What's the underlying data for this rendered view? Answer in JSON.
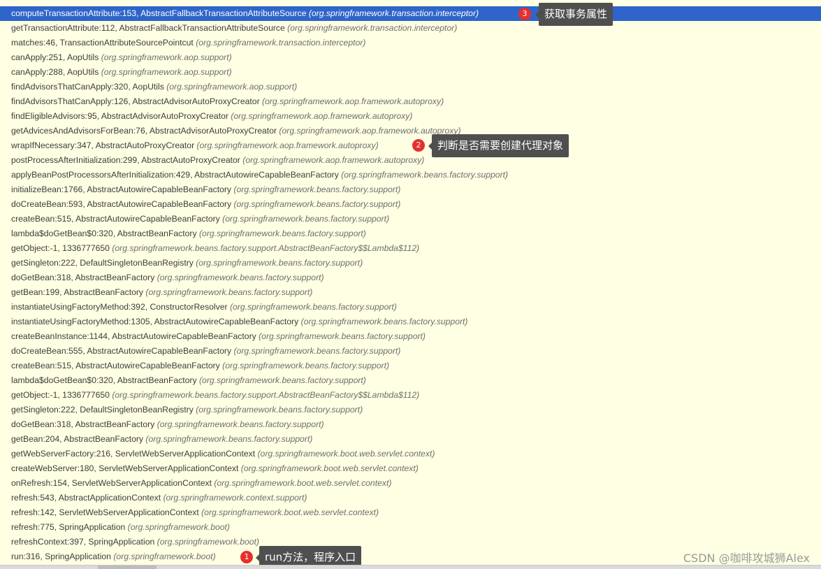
{
  "frames": [
    {
      "method": "computeTransactionAttribute:153, AbstractFallbackTransactionAttributeSource",
      "pkg": "(org.springframework.transaction.interceptor)",
      "selected": true
    },
    {
      "method": "getTransactionAttribute:112, AbstractFallbackTransactionAttributeSource",
      "pkg": "(org.springframework.transaction.interceptor)"
    },
    {
      "method": "matches:46, TransactionAttributeSourcePointcut",
      "pkg": "(org.springframework.transaction.interceptor)"
    },
    {
      "method": "canApply:251, AopUtils",
      "pkg": "(org.springframework.aop.support)"
    },
    {
      "method": "canApply:288, AopUtils",
      "pkg": "(org.springframework.aop.support)"
    },
    {
      "method": "findAdvisorsThatCanApply:320, AopUtils",
      "pkg": "(org.springframework.aop.support)"
    },
    {
      "method": "findAdvisorsThatCanApply:126, AbstractAdvisorAutoProxyCreator",
      "pkg": "(org.springframework.aop.framework.autoproxy)"
    },
    {
      "method": "findEligibleAdvisors:95, AbstractAdvisorAutoProxyCreator",
      "pkg": "(org.springframework.aop.framework.autoproxy)"
    },
    {
      "method": "getAdvicesAndAdvisorsForBean:76, AbstractAdvisorAutoProxyCreator",
      "pkg": "(org.springframework.aop.framework.autoproxy)"
    },
    {
      "method": "wrapIfNecessary:347, AbstractAutoProxyCreator",
      "pkg": "(org.springframework.aop.framework.autoproxy)"
    },
    {
      "method": "postProcessAfterInitialization:299, AbstractAutoProxyCreator",
      "pkg": "(org.springframework.aop.framework.autoproxy)"
    },
    {
      "method": "applyBeanPostProcessorsAfterInitialization:429, AbstractAutowireCapableBeanFactory",
      "pkg": "(org.springframework.beans.factory.support)"
    },
    {
      "method": "initializeBean:1766, AbstractAutowireCapableBeanFactory",
      "pkg": "(org.springframework.beans.factory.support)"
    },
    {
      "method": "doCreateBean:593, AbstractAutowireCapableBeanFactory",
      "pkg": "(org.springframework.beans.factory.support)"
    },
    {
      "method": "createBean:515, AbstractAutowireCapableBeanFactory",
      "pkg": "(org.springframework.beans.factory.support)"
    },
    {
      "method": "lambda$doGetBean$0:320, AbstractBeanFactory",
      "pkg": "(org.springframework.beans.factory.support)"
    },
    {
      "method": "getObject:-1, 1336777650",
      "pkg": "(org.springframework.beans.factory.support.AbstractBeanFactory$$Lambda$112)"
    },
    {
      "method": "getSingleton:222, DefaultSingletonBeanRegistry",
      "pkg": "(org.springframework.beans.factory.support)"
    },
    {
      "method": "doGetBean:318, AbstractBeanFactory",
      "pkg": "(org.springframework.beans.factory.support)"
    },
    {
      "method": "getBean:199, AbstractBeanFactory",
      "pkg": "(org.springframework.beans.factory.support)"
    },
    {
      "method": "instantiateUsingFactoryMethod:392, ConstructorResolver",
      "pkg": "(org.springframework.beans.factory.support)"
    },
    {
      "method": "instantiateUsingFactoryMethod:1305, AbstractAutowireCapableBeanFactory",
      "pkg": "(org.springframework.beans.factory.support)"
    },
    {
      "method": "createBeanInstance:1144, AbstractAutowireCapableBeanFactory",
      "pkg": "(org.springframework.beans.factory.support)"
    },
    {
      "method": "doCreateBean:555, AbstractAutowireCapableBeanFactory",
      "pkg": "(org.springframework.beans.factory.support)"
    },
    {
      "method": "createBean:515, AbstractAutowireCapableBeanFactory",
      "pkg": "(org.springframework.beans.factory.support)"
    },
    {
      "method": "lambda$doGetBean$0:320, AbstractBeanFactory",
      "pkg": "(org.springframework.beans.factory.support)"
    },
    {
      "method": "getObject:-1, 1336777650",
      "pkg": "(org.springframework.beans.factory.support.AbstractBeanFactory$$Lambda$112)"
    },
    {
      "method": "getSingleton:222, DefaultSingletonBeanRegistry",
      "pkg": "(org.springframework.beans.factory.support)"
    },
    {
      "method": "doGetBean:318, AbstractBeanFactory",
      "pkg": "(org.springframework.beans.factory.support)"
    },
    {
      "method": "getBean:204, AbstractBeanFactory",
      "pkg": "(org.springframework.beans.factory.support)"
    },
    {
      "method": "getWebServerFactory:216, ServletWebServerApplicationContext",
      "pkg": "(org.springframework.boot.web.servlet.context)"
    },
    {
      "method": "createWebServer:180, ServletWebServerApplicationContext",
      "pkg": "(org.springframework.boot.web.servlet.context)"
    },
    {
      "method": "onRefresh:154, ServletWebServerApplicationContext",
      "pkg": "(org.springframework.boot.web.servlet.context)"
    },
    {
      "method": "refresh:543, AbstractApplicationContext",
      "pkg": "(org.springframework.context.support)"
    },
    {
      "method": "refresh:142, ServletWebServerApplicationContext",
      "pkg": "(org.springframework.boot.web.servlet.context)"
    },
    {
      "method": "refresh:775, SpringApplication",
      "pkg": "(org.springframework.boot)"
    },
    {
      "method": "refreshContext:397, SpringApplication",
      "pkg": "(org.springframework.boot)"
    },
    {
      "method": "run:316, SpringApplication",
      "pkg": "(org.springframework.boot)"
    }
  ],
  "annotations": [
    {
      "number": "3",
      "text": "获取事务属性"
    },
    {
      "number": "2",
      "text": "判断是否需要创建代理对象"
    },
    {
      "number": "1",
      "text": "run方法，程序入口"
    }
  ],
  "watermark": "CSDN @咖啡攻城狮Alex",
  "colors": {
    "background": "#ffffe3",
    "selection": "#2f65ca",
    "badge": "#e5302e",
    "callout": "#4f4f4f"
  }
}
